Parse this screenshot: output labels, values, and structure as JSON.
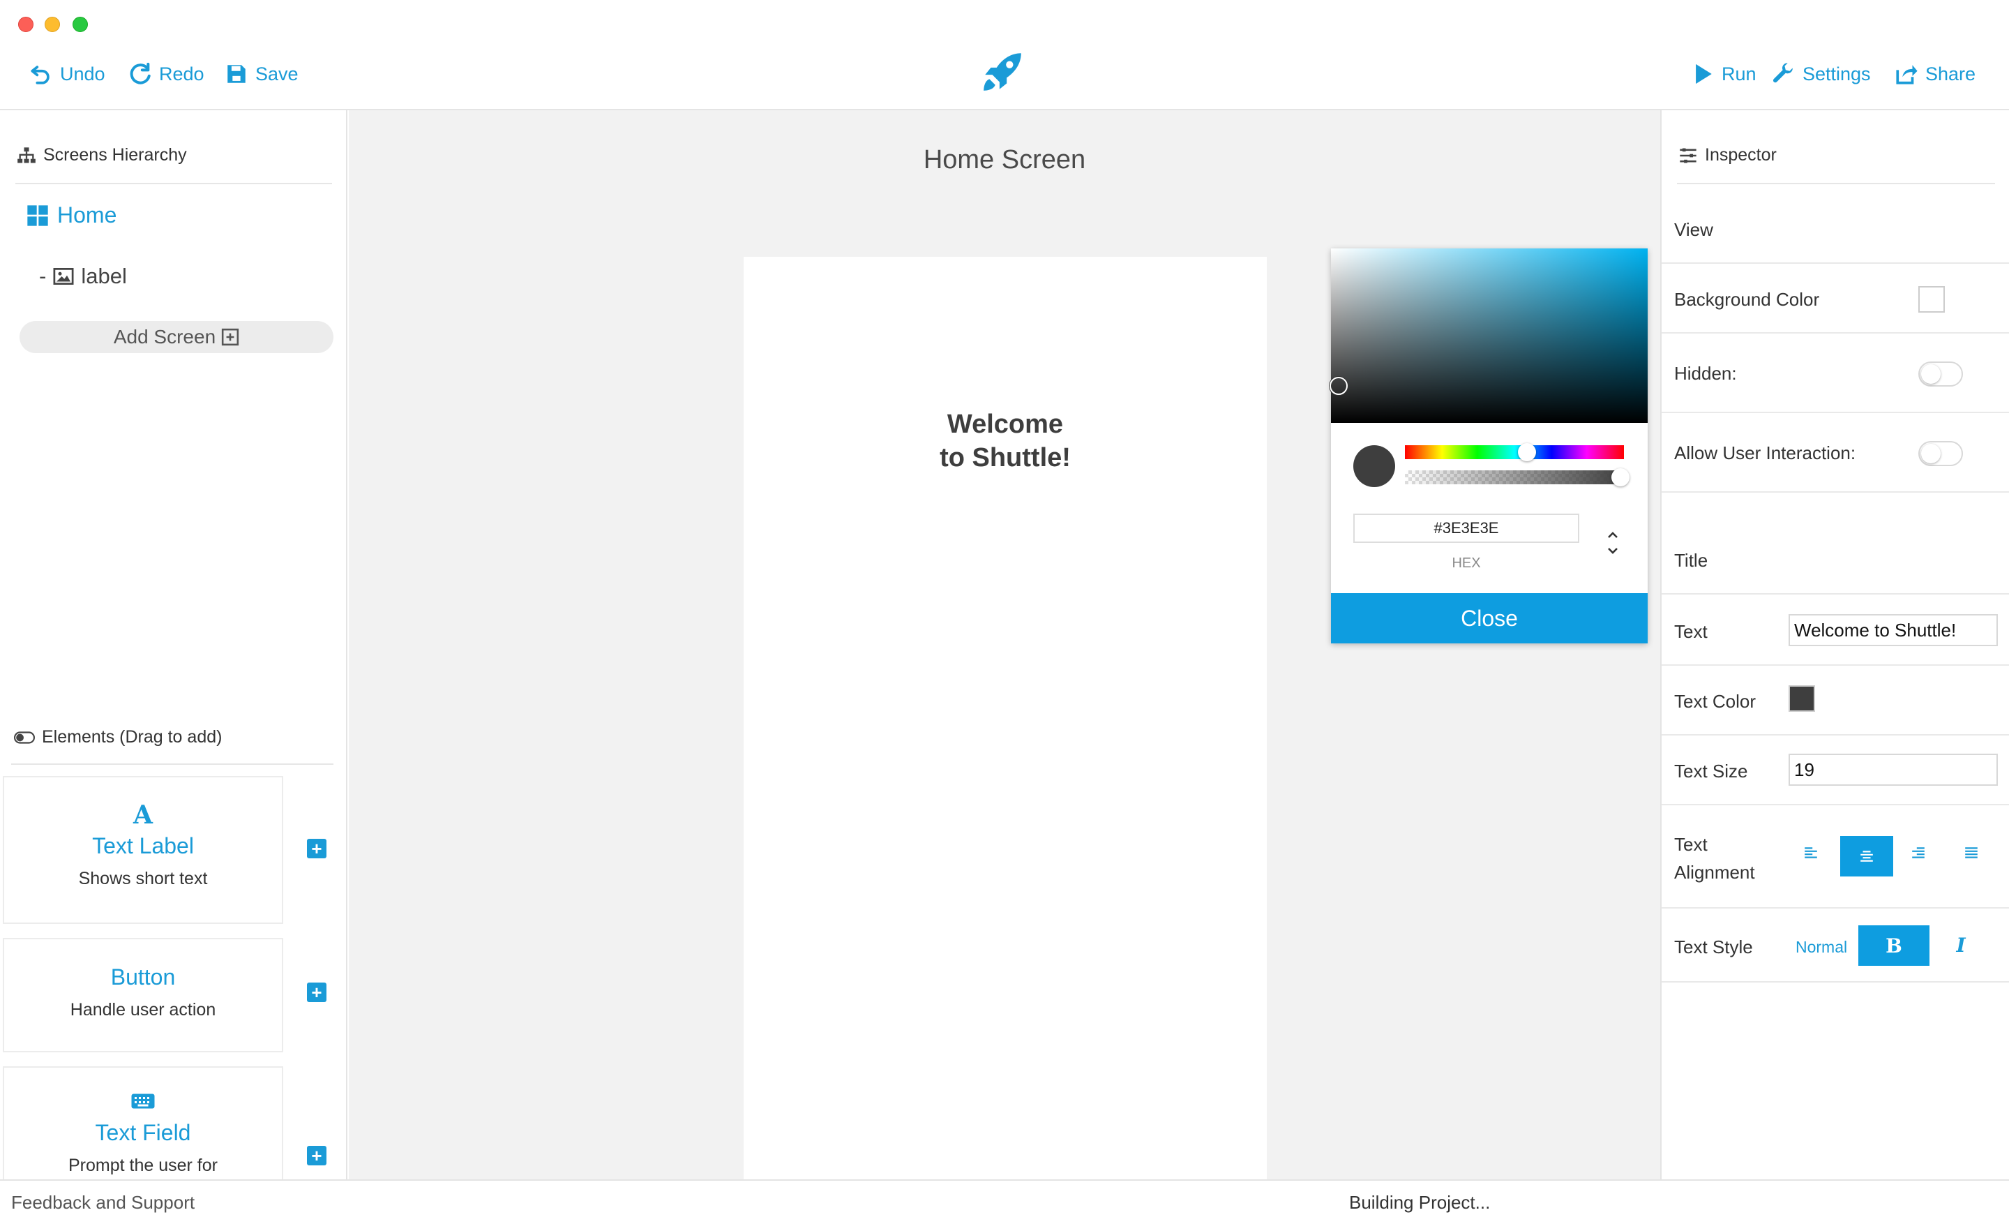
{
  "toolbar": {
    "undo_label": "Undo",
    "redo_label": "Redo",
    "save_label": "Save",
    "run_label": "Run",
    "settings_label": "Settings",
    "share_label": "Share",
    "accent_color": "#1a9bd7",
    "logo_icon": "rocket-icon"
  },
  "left": {
    "hierarchy_title": "Screens Hierarchy",
    "home_label": "Home",
    "child_prefix": "-",
    "child_label": "label",
    "add_screen_label": "Add Screen",
    "elements_title": "Elements (Drag to add)",
    "elements": [
      {
        "title": "Text Label",
        "subtitle": "Shows short text",
        "icon": "letter-a-icon"
      },
      {
        "title": "Button",
        "subtitle": "Handle user action",
        "icon": ""
      },
      {
        "title": "Text Field",
        "subtitle": "Prompt the user for",
        "icon": "keyboard-icon"
      }
    ]
  },
  "center": {
    "screen_title": "Home Screen",
    "welcome_line1": "Welcome",
    "welcome_line2": "to Shuttle!"
  },
  "picker": {
    "hex_value": "#3E3E3E",
    "format_label": "HEX",
    "close_label": "Close",
    "selected_color": "#3e3e3e"
  },
  "inspector": {
    "title": "Inspector",
    "view_section": "View",
    "background_color_label": "Background Color",
    "hidden_label": "Hidden:",
    "allow_interaction_label": "Allow User Interaction:",
    "title_section": "Title",
    "text_label": "Text",
    "text_value": "Welcome to Shuttle!",
    "text_color_label": "Text Color",
    "text_color": "#3e3e3e",
    "text_size_label": "Text Size",
    "text_size_value": "19",
    "text_alignment_label_1": "Text",
    "text_alignment_label_2": "Alignment",
    "text_style_label": "Text Style",
    "style_normal": "Normal",
    "style_bold": "B",
    "style_italic": "I"
  },
  "status": {
    "feedback_label": "Feedback and Support",
    "build_status": "Building Project..."
  }
}
